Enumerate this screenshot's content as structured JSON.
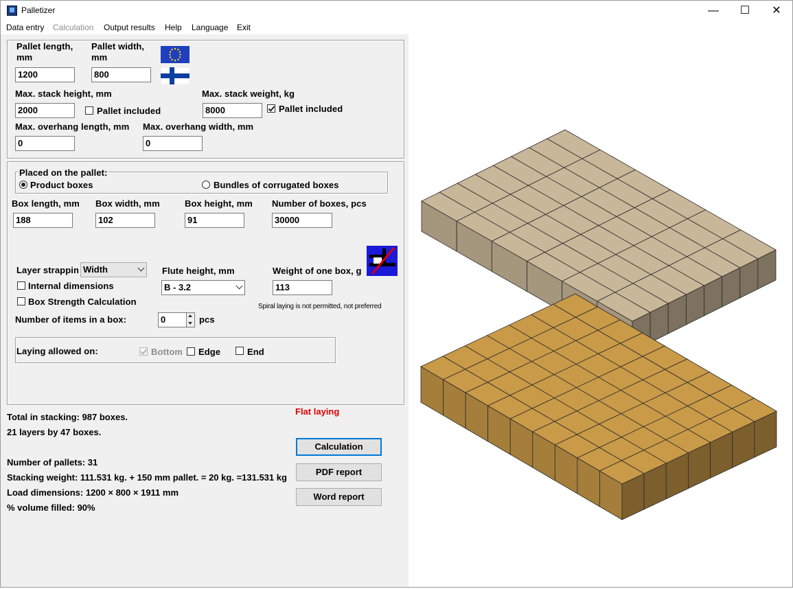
{
  "window": {
    "title": "Palletizer",
    "min": "—",
    "max": "☐",
    "close": "✕"
  },
  "menu": [
    {
      "label": "Data entry",
      "disabled": false
    },
    {
      "label": "Calculation",
      "disabled": true
    },
    {
      "label": "Output results",
      "disabled": false
    },
    {
      "label": "Help",
      "disabled": false
    },
    {
      "label": "Language",
      "disabled": false
    },
    {
      "label": "Exit",
      "disabled": false
    }
  ],
  "pallet": {
    "length_label_1": "Pallet length,",
    "length_label_2": "mm",
    "width_label_1": "Pallet width,",
    "width_label_2": "mm",
    "length": "1200",
    "width": "800",
    "max_height_label": "Max. stack height, mm",
    "max_height": "2000",
    "height_pallet_included": "Pallet included",
    "max_weight_label": "Max. stack weight, kg",
    "max_weight": "8000",
    "weight_pallet_included": "Pallet included",
    "overhang_length_label": "Max. overhang length, mm",
    "overhang_length": "0",
    "overhang_width_label": "Max. overhang width, mm",
    "overhang_width": "0"
  },
  "placed": {
    "title": "Placed on the pallet:",
    "option_product": "Product boxes",
    "option_bundles": "Bundles of corrugated boxes"
  },
  "box": {
    "length_label": "Box length, mm",
    "width_label": "Box width, mm",
    "height_label": "Box height, mm",
    "count_label": "Number of boxes, pcs",
    "length": "188",
    "width": "102",
    "height": "91",
    "count": "30000",
    "strapping_label": "Layer strappin",
    "strapping_value": "Width",
    "flute_label": "Flute height, mm",
    "flute_value": "B - 3.2",
    "weight_label": "Weight of one box, g",
    "weight": "113",
    "internal_dims": "Internal dimensions",
    "strength_calc": "Box Strength Calculation",
    "items_label": "Number of items in a box:",
    "items_value": "0",
    "items_unit": "pcs",
    "spiral_note": "Spiral laying is not permitted, not preferred"
  },
  "laying": {
    "label": "Laying allowed on:",
    "bottom": "Bottom",
    "edge": "Edge",
    "end": "End"
  },
  "results": {
    "total": "Total in stacking: 987 boxes.",
    "layers": "21 layers by 47 boxes.",
    "pallets": "Number of pallets: 31",
    "weight": "Stacking weight: 111.531 kg. + 150 mm pallet. = 20 kg. =131.531 kg",
    "dims": "Load dimensions: 1200 × 800 × 1911 mm",
    "volume": "% volume filled:  90%",
    "flat_laying": "Flat laying"
  },
  "buttons": {
    "calculation": "Calculation",
    "pdf": "PDF report",
    "word": "Word report"
  },
  "colors": {
    "top_layer": "#c9b79a",
    "bottom_layer": "#c99a48",
    "accent": "#0078d7",
    "warning": "#e00000"
  }
}
